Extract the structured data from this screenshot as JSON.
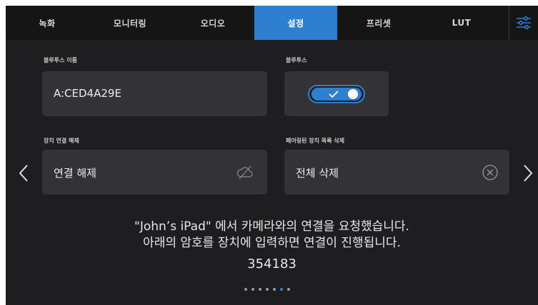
{
  "tabs": [
    {
      "label": "녹화"
    },
    {
      "label": "모니터링"
    },
    {
      "label": "오디오"
    },
    {
      "label": "설정",
      "active": true
    },
    {
      "label": "프리셋"
    },
    {
      "label": "LUT"
    }
  ],
  "menu_icon": "sliders-icon",
  "bluetooth_name": {
    "label": "블루투스 이름",
    "value": "A:CED4A29E"
  },
  "bluetooth": {
    "label": "블루투스",
    "enabled": true
  },
  "disconnect": {
    "label": "장치 연결 해제",
    "button_label": "연결 해제",
    "icon": "cloud-off-icon"
  },
  "delete_paired": {
    "label": "페어링된 장치 목록 삭제",
    "button_label": "전체 삭제",
    "icon": "circle-x-icon"
  },
  "message": {
    "line1": "\"John’s iPad\" 에서 카메라와의 연결을 요청했습니다.",
    "line2": "아래의 암호를 장치에 입력하면 연결이 진행됩니다.",
    "code": "354183"
  },
  "pagination": {
    "total": 7,
    "current": 6
  },
  "colors": {
    "accent": "#2f7fd0",
    "background": "#1e1e20",
    "panel": "#333336"
  }
}
